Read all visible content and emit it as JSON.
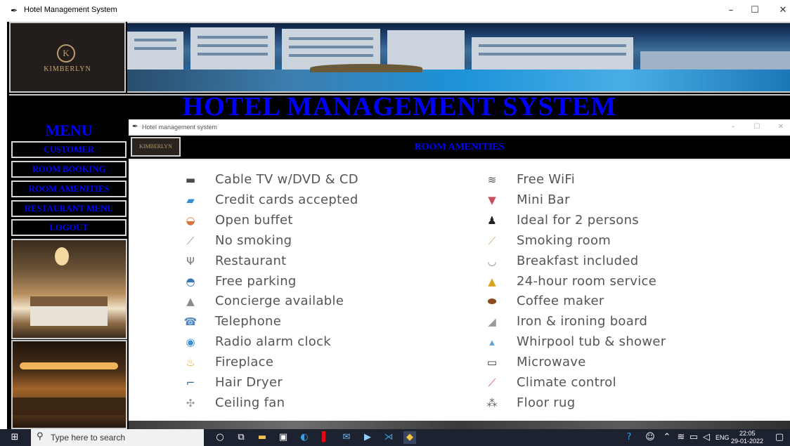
{
  "window": {
    "title": "Hotel Management System",
    "controls": {
      "minimize": "–",
      "maximize": "☐",
      "close": "✕"
    }
  },
  "logo": {
    "emblem": "K",
    "name": "KIMBERLYN"
  },
  "header": {
    "title": "HOTEL MANAGEMENT SYSTEM"
  },
  "menu": {
    "title": "MENU",
    "items": [
      {
        "label": "CUSTOMER"
      },
      {
        "label": "ROOM BOOKING"
      },
      {
        "label": "ROOM AMENITIES"
      },
      {
        "label": "RESTAURANT MENU"
      },
      {
        "label": "LOGOUT"
      }
    ]
  },
  "child_window": {
    "title": "Hotel management system",
    "controls": {
      "minimize": "–",
      "maximize": "☐",
      "close": "✕"
    },
    "logo_text": "KIMBERLYN",
    "heading": "ROOM AMENITIES"
  },
  "amenities": {
    "left": [
      {
        "label": "Cable TV w/DVD & CD",
        "icon": "tv-icon",
        "glyph": "▬",
        "color": "#4a4a4a"
      },
      {
        "label": "Credit cards accepted",
        "icon": "credit-card-icon",
        "glyph": "▰",
        "color": "#2f8fd6"
      },
      {
        "label": "Open buffet",
        "icon": "buffet-icon",
        "glyph": "◒",
        "color": "#d8733b"
      },
      {
        "label": "No smoking",
        "icon": "no-smoking-icon",
        "glyph": "⟋",
        "color": "#8f8f8f"
      },
      {
        "label": "Restaurant",
        "icon": "restaurant-icon",
        "glyph": "Ψ",
        "color": "#7a7a7a"
      },
      {
        "label": "Free parking",
        "icon": "car-icon",
        "glyph": "◓",
        "color": "#3c78b8"
      },
      {
        "label": "Concierge available",
        "icon": "concierge-bell-icon",
        "glyph": "▲",
        "color": "#8a8a8a"
      },
      {
        "label": "Telephone",
        "icon": "telephone-icon",
        "glyph": "☎",
        "color": "#4f8ac7"
      },
      {
        "label": "Radio alarm clock",
        "icon": "alarm-clock-icon",
        "glyph": "◉",
        "color": "#3b8fd1"
      },
      {
        "label": "Fireplace",
        "icon": "fireplace-icon",
        "glyph": "♨",
        "color": "#e59a1f"
      },
      {
        "label": "Hair Dryer",
        "icon": "hair-dryer-icon",
        "glyph": "⌐",
        "color": "#2e6d9e"
      },
      {
        "label": "Ceiling fan",
        "icon": "ceiling-fan-icon",
        "glyph": "✣",
        "color": "#9a9a9a"
      }
    ],
    "right": [
      {
        "label": "Free WiFi",
        "icon": "wifi-icon",
        "glyph": "≋",
        "color": "#555555"
      },
      {
        "label": "Mini Bar",
        "icon": "mini-bar-icon",
        "glyph": "▼",
        "color": "#c8505a"
      },
      {
        "label": "Ideal for 2 persons",
        "icon": "persons-icon",
        "glyph": "♟",
        "color": "#222222"
      },
      {
        "label": "Smoking room",
        "icon": "cigarette-icon",
        "glyph": "⟋",
        "color": "#c9a46a"
      },
      {
        "label": "Breakfast included",
        "icon": "breakfast-icon",
        "glyph": "◡",
        "color": "#8a8a8a"
      },
      {
        "label": "24-hour room service",
        "icon": "room-service-icon",
        "glyph": "▲",
        "color": "#d9a520"
      },
      {
        "label": "Coffee maker",
        "icon": "coffee-bean-icon",
        "glyph": "⬬",
        "color": "#8b4a1f"
      },
      {
        "label": "Iron & ironing board",
        "icon": "iron-icon",
        "glyph": "◢",
        "color": "#9a9a9a"
      },
      {
        "label": "Whirpool tub & shower",
        "icon": "water-drop-icon",
        "glyph": "▴",
        "color": "#5aa3dc"
      },
      {
        "label": "Microwave",
        "icon": "microwave-icon",
        "glyph": "▭",
        "color": "#333333"
      },
      {
        "label": "Climate control",
        "icon": "thermometer-icon",
        "glyph": "⟋",
        "color": "#d04a5a"
      },
      {
        "label": "Floor rug",
        "icon": "rug-icon",
        "glyph": "⁂",
        "color": "#666666"
      }
    ]
  },
  "taskbar": {
    "search_placeholder": "Type here to search",
    "language": "ENG",
    "time": "22:05",
    "date": "29-01-2022"
  }
}
